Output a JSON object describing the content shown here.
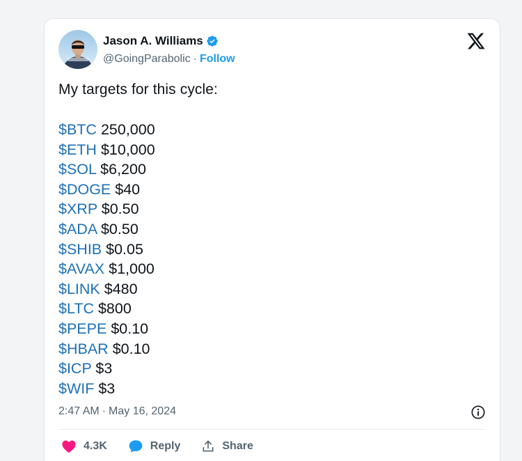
{
  "tweet": {
    "author": {
      "display_name": "Jason A. Williams",
      "handle": "@GoingParabolic",
      "separator": "·",
      "follow_label": "Follow"
    },
    "intro": "My targets for this cycle:",
    "targets": [
      {
        "ticker": "$BTC",
        "price": "250,000"
      },
      {
        "ticker": "$ETH",
        "price": "$10,000"
      },
      {
        "ticker": "$SOL",
        "price": "$6,200"
      },
      {
        "ticker": "$DOGE",
        "price": "$40"
      },
      {
        "ticker": "$XRP",
        "price": "$0.50"
      },
      {
        "ticker": "$ADA",
        "price": "$0.50"
      },
      {
        "ticker": "$SHIB",
        "price": "$0.05"
      },
      {
        "ticker": "$AVAX",
        "price": "$1,000"
      },
      {
        "ticker": "$LINK",
        "price": "$480"
      },
      {
        "ticker": "$LTC",
        "price": "$800"
      },
      {
        "ticker": "$PEPE",
        "price": "$0.10"
      },
      {
        "ticker": "$HBAR",
        "price": "$0.10"
      },
      {
        "ticker": "$ICP",
        "price": "$3"
      },
      {
        "ticker": "$WIF",
        "price": "$3"
      }
    ],
    "time": "2:47 AM",
    "date": "May 16, 2024",
    "date_separator": "·",
    "actions": {
      "like_count": "4.3K",
      "reply_label": "Reply",
      "share_label": "Share"
    }
  },
  "icons": {
    "brand": "x-logo-icon",
    "verified": "verified-badge-icon",
    "info": "info-icon",
    "like": "heart-icon",
    "reply": "speech-bubble-icon",
    "share": "share-arrow-icon"
  },
  "colors": {
    "cashtag": "#1d70b7",
    "follow": "#1d9bf0",
    "verified": "#1d9bf0",
    "like": "#f91880",
    "reply": "#1d9bf0",
    "text": "#0f1419",
    "muted": "#536471"
  }
}
